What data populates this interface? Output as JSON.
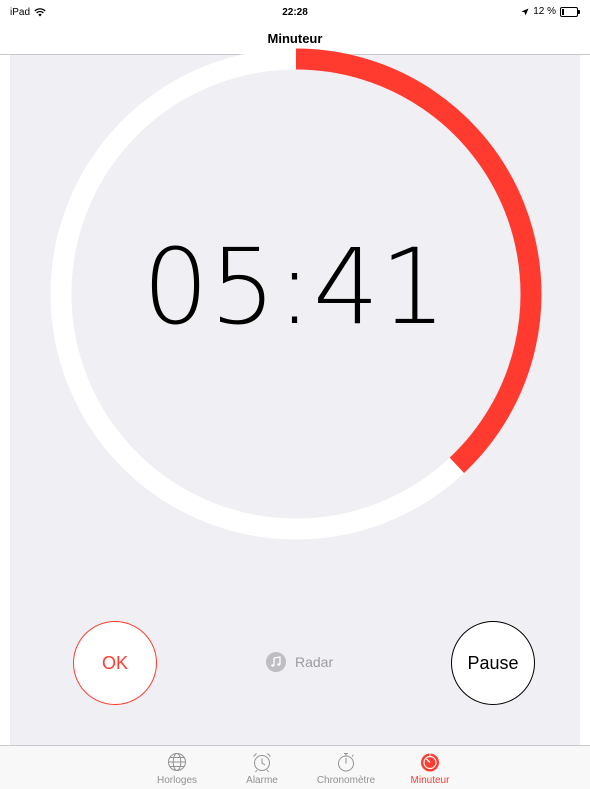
{
  "status_bar": {
    "device": "iPad",
    "time": "22:28",
    "battery_text": "12 %",
    "battery_level": 0.12
  },
  "nav": {
    "title": "Minuteur"
  },
  "timer": {
    "minutes": "05",
    "separator": ":",
    "seconds": "41",
    "remaining_fraction": 0.38,
    "progress_color": "#ff3b30",
    "track_color": "#ffffff"
  },
  "actions": {
    "ok_label": "OK",
    "pause_label": "Pause",
    "sound_label": "Radar",
    "sound_icon": "music-note-icon"
  },
  "tabs": [
    {
      "label": "Horloges",
      "icon": "globe-icon",
      "active": false
    },
    {
      "label": "Alarme",
      "icon": "alarm-clock-icon",
      "active": false
    },
    {
      "label": "Chronomètre",
      "icon": "stopwatch-icon",
      "active": false
    },
    {
      "label": "Minuteur",
      "icon": "timer-icon",
      "active": true
    }
  ],
  "colors": {
    "accent": "#ff3b30",
    "background": "#efeff4"
  }
}
